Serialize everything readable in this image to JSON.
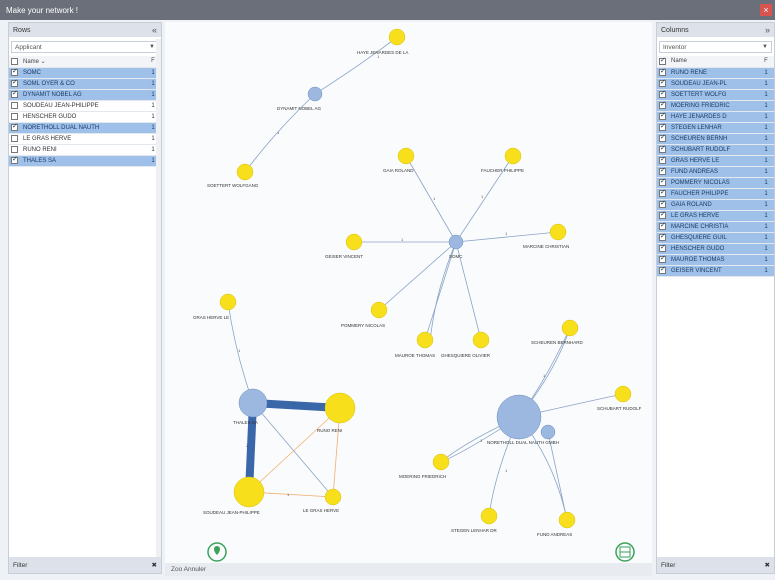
{
  "window": {
    "title": "Make your network !",
    "close_icon": "close-icon"
  },
  "left_panel": {
    "header": "Rows",
    "select_value": "Applicant",
    "columns": {
      "name": "Name",
      "f": "F"
    },
    "rows": [
      {
        "name": "SOMC",
        "f": "1",
        "checked": true
      },
      {
        "name": "SOML OYER & CO",
        "f": "1",
        "checked": true
      },
      {
        "name": "DYNAMIT NOBEL AG",
        "f": "1",
        "checked": true
      },
      {
        "name": "SOUDEAU JEAN-PHILIPPE",
        "f": "1",
        "checked": false
      },
      {
        "name": "HENSCHER GUDO",
        "f": "1",
        "checked": false
      },
      {
        "name": "NORETHOLL DUAL NAUTH",
        "f": "1",
        "checked": true
      },
      {
        "name": "LE GRAS HERVE",
        "f": "1",
        "checked": false
      },
      {
        "name": "RUNO RENI",
        "f": "1",
        "checked": false
      },
      {
        "name": "THALES SA",
        "f": "1",
        "checked": true
      }
    ],
    "footer": "Filter"
  },
  "right_panel": {
    "header": "Columns",
    "select_value": "Inventor",
    "columns": {
      "name": "Name",
      "f": "F"
    },
    "rows": [
      {
        "name": "RUNO RENE",
        "f": "1"
      },
      {
        "name": "SOUDEAU JEAN-PL",
        "f": "1"
      },
      {
        "name": "SOETTERT WOLFG",
        "f": "1"
      },
      {
        "name": "MOERING FRIEDRIC",
        "f": "1"
      },
      {
        "name": "HAYE JENARDES D",
        "f": "1"
      },
      {
        "name": "STEGEN LENHAR",
        "f": "1"
      },
      {
        "name": "SCHEUREN BERNH",
        "f": "1"
      },
      {
        "name": "SCHUBART RUDOLF",
        "f": "1"
      },
      {
        "name": "GRAS HERVE LE",
        "f": "1"
      },
      {
        "name": "FUND ANDREAS",
        "f": "1"
      },
      {
        "name": "POMMERY NICOLAS",
        "f": "1"
      },
      {
        "name": "FAUCHER PHILIPPE",
        "f": "1"
      },
      {
        "name": "GAIA ROLAND",
        "f": "1"
      },
      {
        "name": "LE GRAS HERVE",
        "f": "1"
      },
      {
        "name": "MARCINE CHRISTIA",
        "f": "1"
      },
      {
        "name": "GHESQUIERE GUIL",
        "f": "1"
      },
      {
        "name": "HENSCHER GUDO",
        "f": "1"
      },
      {
        "name": "MAUROE THOMAS",
        "f": "1"
      },
      {
        "name": "GEISER VINCENT",
        "f": "1"
      }
    ],
    "footer": "Filter"
  },
  "status_bar": "Zoo Annuler",
  "graph": {
    "labels": {
      "haye": "HAYE JENARDES DE LA",
      "dynamit": "DYNAMIT NOBEL AG",
      "soettert": "SOETTERT WOLFGANG",
      "gaia": "GAIA ROLAND",
      "faucher": "FAUCHER PHILIPPE",
      "geiser": "GEISER VINCENT",
      "somc": "SOMC",
      "marcine": "MARCINE CHRISTIAN",
      "pommery": "POMMERY NICOLAS",
      "mauroe": "MAUROE THOMAS",
      "ghesquiere": "GHESQUIERE OLIVIER",
      "gras_herve_le": "GRAS HERVE LE",
      "thales": "THALES SA",
      "runo": "RUNO RENI",
      "soudeau": "SOUDEAU JEAN-PHILIPPE",
      "le_gras": "LE GRAS HERVE",
      "scheuren": "SCHEUREN BERNHARD",
      "schubart": "SCHUBART RUDOLF",
      "noretholl": "NORETHOLL DUAL NAUTH GMBH",
      "moering": "MOERING FRIEDRICH",
      "stegen": "STEGEN LENHAR DR",
      "fund": "FUND ANDREAS"
    },
    "edge_weight": "1",
    "thick_edge_weight": "2"
  },
  "icons": {
    "left_bottom": "location-pin-icon",
    "right_bottom": "network-icon"
  }
}
